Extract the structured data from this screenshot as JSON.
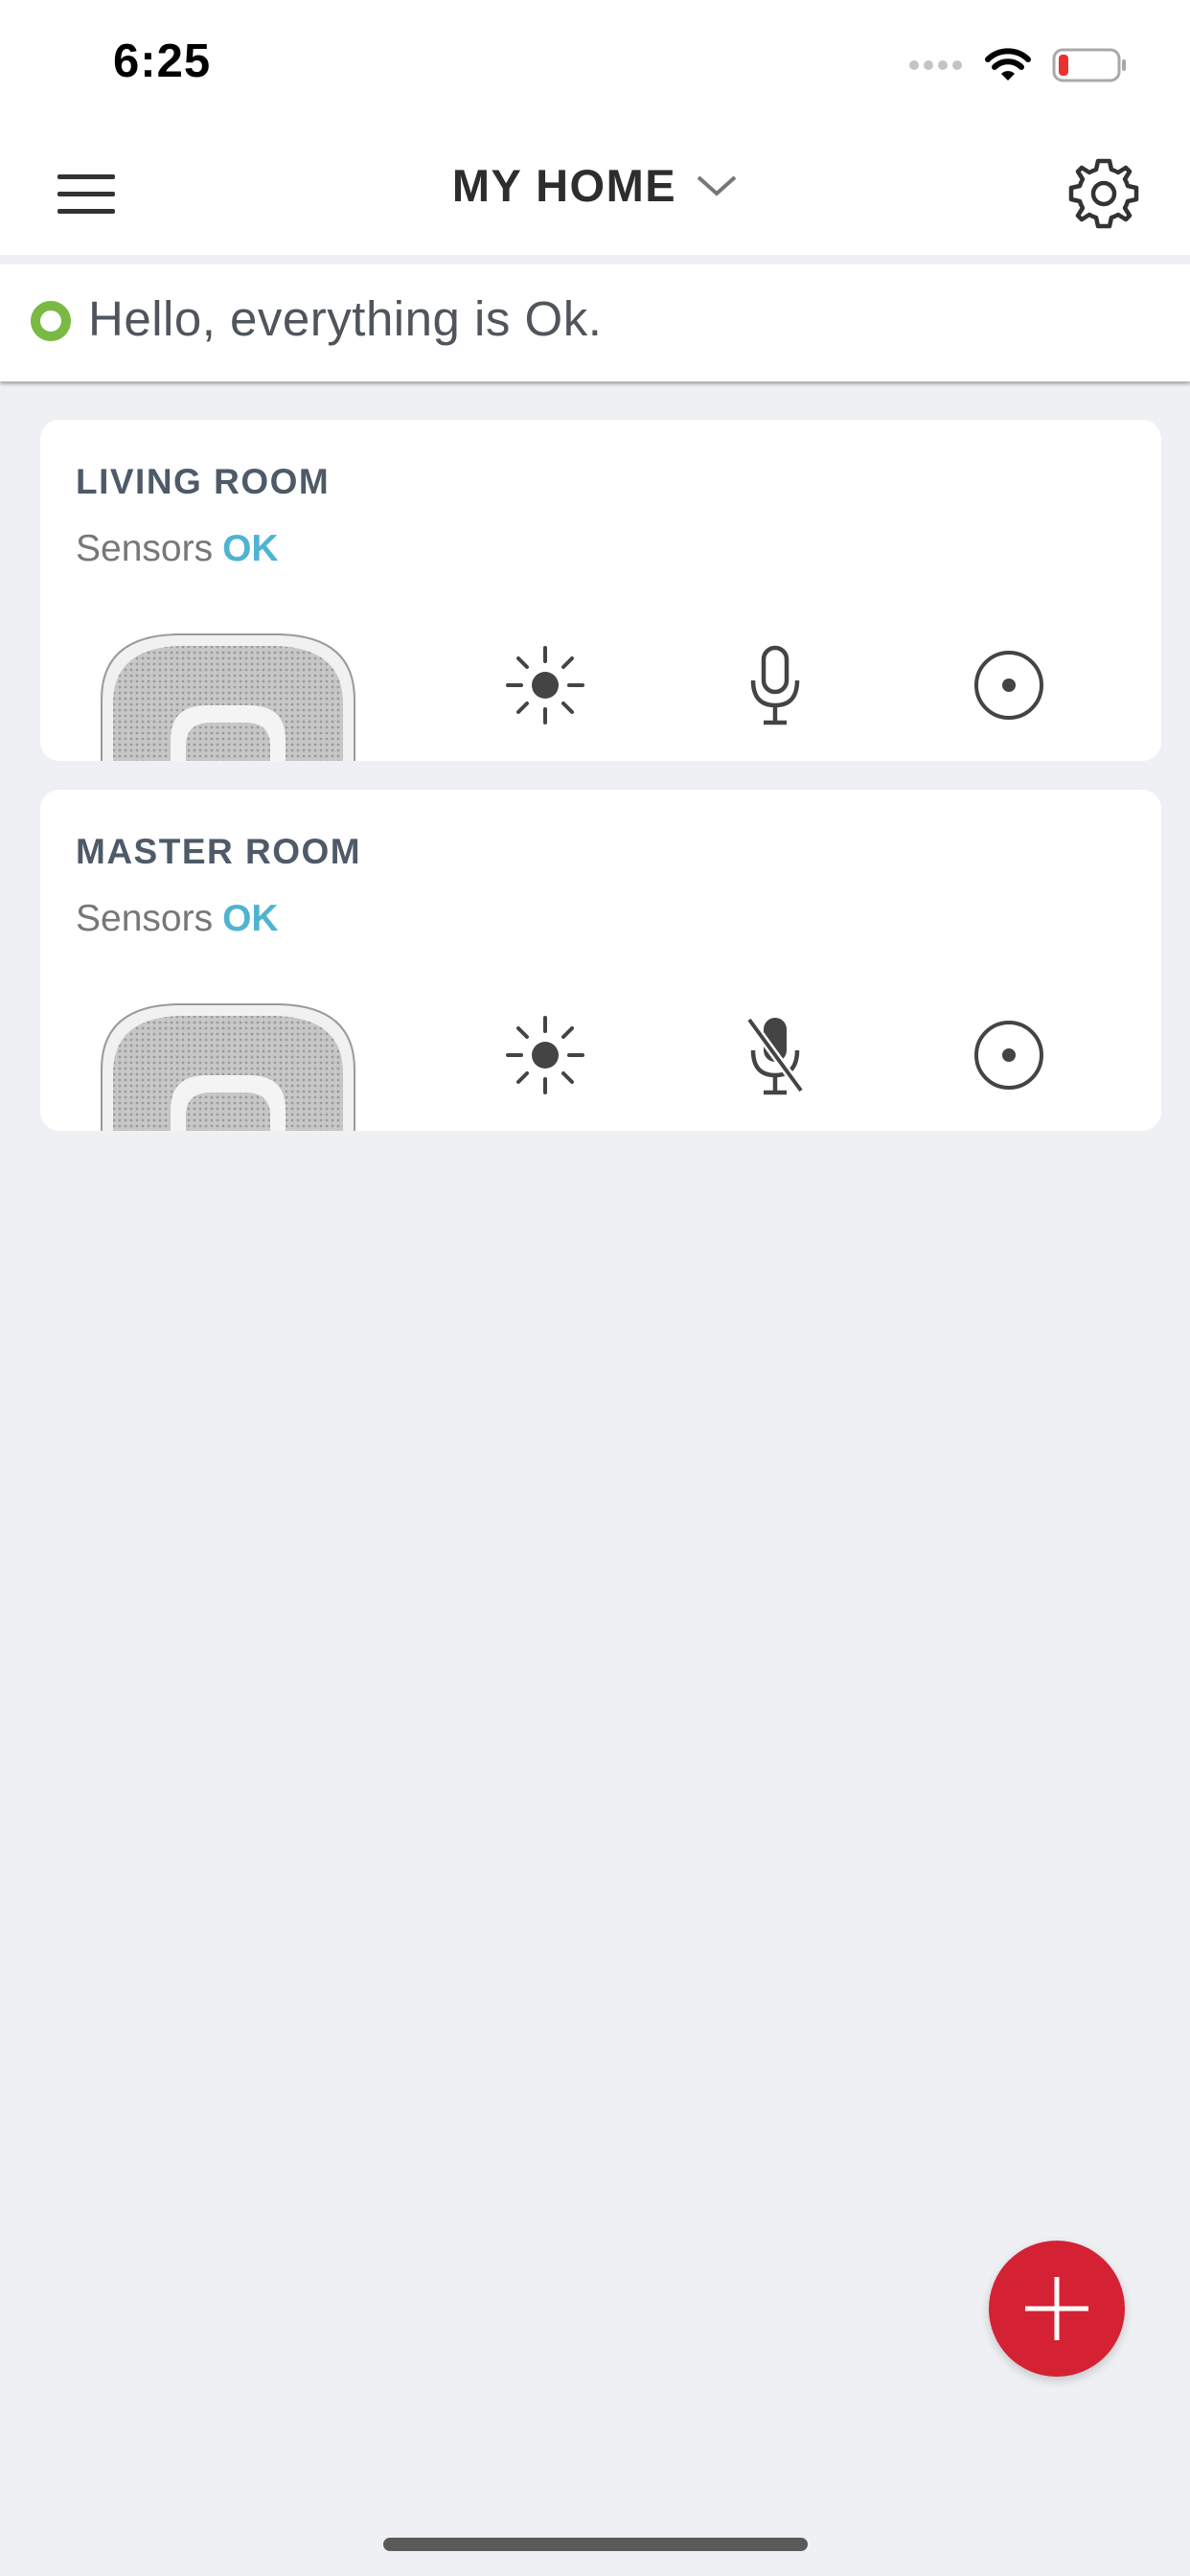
{
  "status_bar": {
    "time": "6:25",
    "icons": [
      "signal-icon",
      "wifi-icon",
      "battery-low-icon"
    ],
    "battery_color": "#e8322f"
  },
  "header": {
    "title": "MY HOME",
    "menu_icon": "hamburger-menu-icon",
    "dropdown_icon": "chevron-down-icon",
    "settings_icon": "gear-icon"
  },
  "banner": {
    "message": "Hello, everything is Ok.",
    "status_color": "#7ab943"
  },
  "rooms": [
    {
      "name": "LIVING ROOM",
      "sensors_label": "Sensors",
      "sensors_status": "OK",
      "controls": [
        "sun-icon",
        "microphone-icon",
        "camera-dot-icon"
      ]
    },
    {
      "name": "MASTER ROOM",
      "sensors_label": "Sensors",
      "sensors_status": "OK",
      "controls": [
        "sun-icon",
        "microphone-muted-icon",
        "camera-dot-icon"
      ]
    }
  ],
  "fab": {
    "icon": "plus-icon",
    "color": "#d42234"
  },
  "colors": {
    "accent_ok": "#4fb3d2",
    "background": "#eff0f4"
  }
}
